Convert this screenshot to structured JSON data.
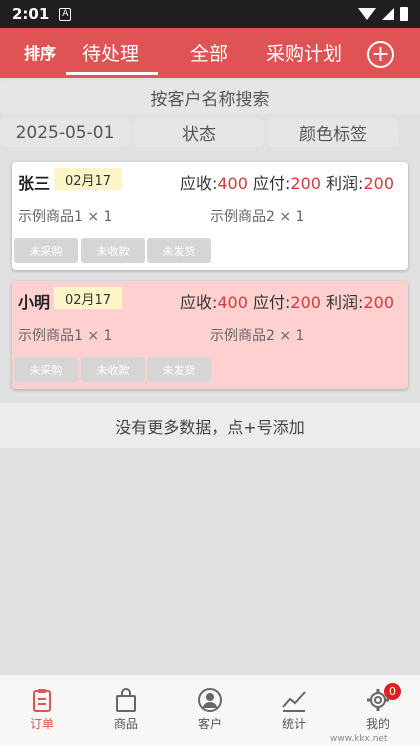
{
  "status": {
    "time": "2:01",
    "notif_icon": "A"
  },
  "header": {
    "sort_label": "排序",
    "tabs": [
      {
        "label": "待处理",
        "active": true
      },
      {
        "label": "全部"
      },
      {
        "label": "采购计划"
      }
    ],
    "add_icon": "+"
  },
  "search": {
    "placeholder": "按客户名称搜索"
  },
  "filters": {
    "date": "2025-05-01",
    "status": "状态",
    "color_tag": "颜色标签"
  },
  "orders": [
    {
      "customer": "张三",
      "date": "02月17",
      "receivable_label": "应收:",
      "receivable": "400",
      "payable_label": "应付:",
      "payable": "200",
      "profit_label": "利润:",
      "profit": "200",
      "items": [
        "示例商品1 × 1",
        "示例商品2 × 1"
      ],
      "chips": [
        "未采购",
        "未收款",
        "未发货"
      ],
      "bg": "#ffffff"
    },
    {
      "customer": "小明",
      "date": "02月17",
      "receivable_label": "应收:",
      "receivable": "400",
      "payable_label": "应付:",
      "payable": "200",
      "profit_label": "利润:",
      "profit": "200",
      "items": [
        "示例商品1 × 1",
        "示例商品2 × 1"
      ],
      "chips": [
        "未采购",
        "未收款",
        "未发货"
      ],
      "bg": "#ffd0d0"
    }
  ],
  "no_more_text": "没有更多数据，点+号添加",
  "nav": [
    {
      "label": "订单",
      "icon": "clipboard-icon",
      "active": true
    },
    {
      "label": "商品",
      "icon": "bag-icon"
    },
    {
      "label": "客户",
      "icon": "person-icon"
    },
    {
      "label": "统计",
      "icon": "chart-icon"
    },
    {
      "label": "我的",
      "icon": "gear-icon",
      "badge": "0"
    }
  ],
  "watermark": "www.kkx.net",
  "colors": {
    "accent": "#e05354",
    "amount": "#d23b3b"
  }
}
